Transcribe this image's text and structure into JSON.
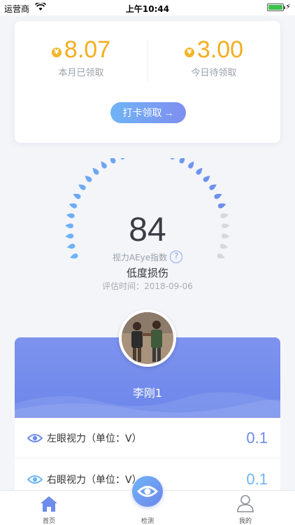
{
  "status_bar": {
    "carrier": "运营商",
    "time": "上午10:44"
  },
  "rewards": {
    "month_received": {
      "value": "8.07",
      "caption": "本月已领取"
    },
    "today_pending": {
      "value": "3.00",
      "caption": "今日待领取"
    },
    "coin_symbol": "¥",
    "checkin_label": "打卡领取",
    "checkin_arrow": "→"
  },
  "gauge": {
    "score": "84",
    "score_value": 84,
    "score_max": 100,
    "index_label": "视力AEye指数",
    "help_symbol": "?",
    "level": "低度损伤",
    "date_text": "评估时间：2018-09-06",
    "colors": {
      "active": "#6d8cec",
      "inactive": "#d6d8dc"
    }
  },
  "profile": {
    "name": "李刚1"
  },
  "vision": [
    {
      "label": "左眼视力（单位：V）",
      "value": "0.1"
    },
    {
      "label": "右眼视力（单位：V）",
      "value": "0.1"
    }
  ],
  "tabs": [
    {
      "label": "首页",
      "icon": "home-icon"
    },
    {
      "label": "检测",
      "icon": "eye-icon"
    },
    {
      "label": "我的",
      "icon": "user-icon"
    }
  ]
}
